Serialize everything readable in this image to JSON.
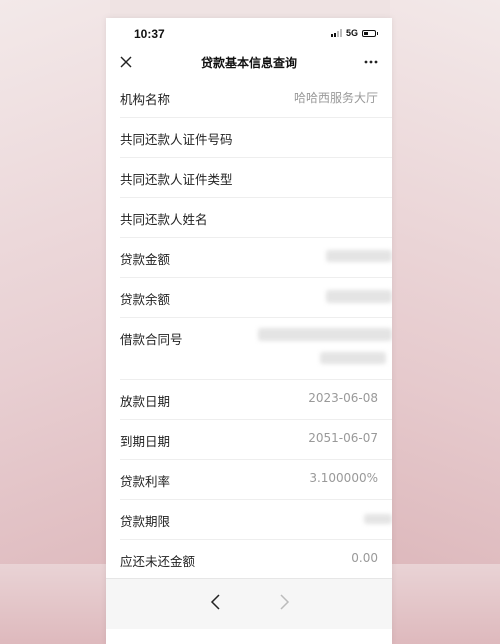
{
  "status_bar": {
    "time": "10:37",
    "network": "5G"
  },
  "nav": {
    "title": "贷款基本信息查询",
    "close_icon": "close-icon",
    "more_icon": "more-dots-icon"
  },
  "rows": [
    {
      "label": "机构名称",
      "value": "哈哈西服务大厅"
    },
    {
      "label": "共同还款人证件号码",
      "value": ""
    },
    {
      "label": "共同还款人证件类型",
      "value": ""
    },
    {
      "label": "共同还款人姓名",
      "value": ""
    },
    {
      "label": "贷款金额",
      "value": ""
    },
    {
      "label": "贷款余额",
      "value": ""
    },
    {
      "label": "借款合同号",
      "value": ""
    },
    {
      "label": "放款日期",
      "value": "2023-06-08"
    },
    {
      "label": "到期日期",
      "value": "2051-06-07"
    },
    {
      "label": "贷款利率",
      "value": "3.100000%"
    },
    {
      "label": "贷款期限",
      "value": ""
    },
    {
      "label": "应还未还金额",
      "value": "0.00"
    }
  ],
  "toolbar": {
    "back_icon": "chevron-left-icon",
    "forward_icon": "chevron-right-icon"
  },
  "colors": {
    "background": "#efe3e3",
    "accent_pink": "#dcb5b9",
    "screen": "#ffffff",
    "label_text": "#222222",
    "value_text": "#999999"
  }
}
